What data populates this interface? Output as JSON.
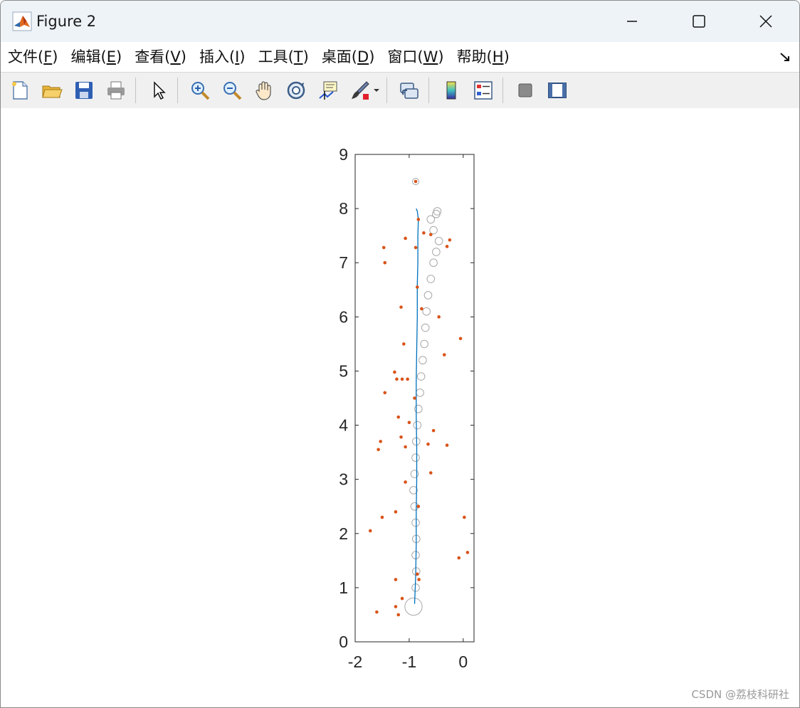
{
  "window": {
    "title": "Figure 2",
    "controls": [
      "minimize",
      "maximize",
      "close"
    ]
  },
  "menubar": {
    "items": [
      {
        "label": "文件(",
        "key": "F",
        "end": ")"
      },
      {
        "label": "编辑(",
        "key": "E",
        "end": ")"
      },
      {
        "label": "查看(",
        "key": "V",
        "end": ")"
      },
      {
        "label": "插入(",
        "key": "I",
        "end": ")"
      },
      {
        "label": "工具(",
        "key": "T",
        "end": ")"
      },
      {
        "label": "桌面(",
        "key": "D",
        "end": ")"
      },
      {
        "label": "窗口(",
        "key": "W",
        "end": ")"
      },
      {
        "label": "帮助(",
        "key": "H",
        "end": ")"
      }
    ]
  },
  "toolbar": {
    "buttons": [
      "new-figure-icon",
      "open-file-icon",
      "save-icon",
      "print-icon",
      "pointer-icon",
      "zoom-in-icon",
      "zoom-out-icon",
      "pan-hand-icon",
      "rotate-3d-icon",
      "data-cursor-icon",
      "brush-icon",
      "link-plot-icon",
      "colorbar-icon",
      "legend-icon",
      "hide-plot-tools-icon",
      "show-plot-tools-icon"
    ]
  },
  "watermark": "CSDN @荔枝科研社",
  "chart_data": {
    "type": "scatter",
    "title": "",
    "xlabel": "",
    "ylabel": "",
    "xlim": [
      -2,
      0.2
    ],
    "ylim": [
      0,
      9
    ],
    "xticks": [
      "-2",
      "-1",
      "0"
    ],
    "yticks": [
      "0",
      "1",
      "2",
      "3",
      "4",
      "5",
      "6",
      "7",
      "8",
      "9"
    ],
    "grid": false,
    "colors": {
      "line": "#0072bd",
      "points": "#d95319",
      "circles": "#a8a8a8"
    },
    "trajectory": {
      "x": [
        -0.9,
        -0.88,
        -0.87,
        -0.87,
        -0.86,
        -0.86,
        -0.87,
        -0.87,
        -0.86,
        -0.85,
        -0.85,
        -0.84,
        -0.84,
        -0.83,
        -0.85,
        -0.87
      ],
      "y": [
        0.7,
        1.2,
        1.8,
        2.4,
        3.0,
        3.6,
        4.2,
        4.8,
        5.4,
        6.0,
        6.6,
        7.0,
        7.5,
        7.8,
        7.95,
        8.0
      ]
    },
    "estimate_circles": {
      "x": [
        -0.92,
        -0.88,
        -0.87,
        -0.88,
        -0.87,
        -0.88,
        -0.9,
        -0.92,
        -0.9,
        -0.88,
        -0.87,
        -0.85,
        -0.83,
        -0.8,
        -0.78,
        -0.75,
        -0.72,
        -0.7,
        -0.68,
        -0.65,
        -0.6,
        -0.55,
        -0.5,
        -0.45,
        -0.55,
        -0.6,
        -0.5,
        -0.48,
        -0.88
      ],
      "y": [
        0.65,
        1.0,
        1.3,
        1.6,
        1.9,
        2.2,
        2.5,
        2.8,
        3.1,
        3.4,
        3.7,
        4.0,
        4.3,
        4.6,
        4.9,
        5.2,
        5.5,
        5.8,
        6.1,
        6.4,
        6.7,
        7.0,
        7.2,
        7.4,
        7.6,
        7.8,
        7.9,
        7.95,
        8.5
      ],
      "r": [
        1.6,
        0.7,
        0.7,
        0.7,
        0.7,
        0.7,
        0.7,
        0.7,
        0.7,
        0.7,
        0.7,
        0.7,
        0.7,
        0.7,
        0.7,
        0.7,
        0.7,
        0.7,
        0.7,
        0.7,
        0.7,
        0.7,
        0.7,
        0.7,
        0.7,
        0.7,
        0.7,
        0.7,
        0.6
      ]
    },
    "landmarks": {
      "x": [
        -0.88,
        -1.07,
        -0.88,
        -0.83,
        -0.73,
        -0.6,
        -0.25,
        -0.3,
        -1.47,
        -1.45,
        -0.85,
        -1.15,
        -0.77,
        -0.45,
        -0.05,
        -1.1,
        -0.35,
        -1.27,
        -1.23,
        -1.13,
        -1.03,
        -1.45,
        -0.9,
        -1.2,
        -0.55,
        -1.0,
        -1.15,
        -1.53,
        -1.57,
        -0.65,
        -0.3,
        -1.07,
        -0.6,
        -1.07,
        -0.83,
        -1.25,
        -1.5,
        -1.72,
        0.02,
        0.08,
        -0.08,
        -1.25,
        -0.85,
        -0.82,
        -1.13,
        -1.25,
        -1.6,
        -1.2
      ],
      "y": [
        8.5,
        7.45,
        7.28,
        7.8,
        7.55,
        7.52,
        7.42,
        7.3,
        7.28,
        7.0,
        6.55,
        6.18,
        6.15,
        6.0,
        5.6,
        5.5,
        5.3,
        4.98,
        4.85,
        4.85,
        4.85,
        4.6,
        4.5,
        4.15,
        3.9,
        4.05,
        3.78,
        3.7,
        3.55,
        3.65,
        3.63,
        3.6,
        3.12,
        2.95,
        2.5,
        2.4,
        2.3,
        2.05,
        2.3,
        1.65,
        1.55,
        1.15,
        1.25,
        1.15,
        0.8,
        0.65,
        0.55,
        0.5
      ]
    }
  }
}
